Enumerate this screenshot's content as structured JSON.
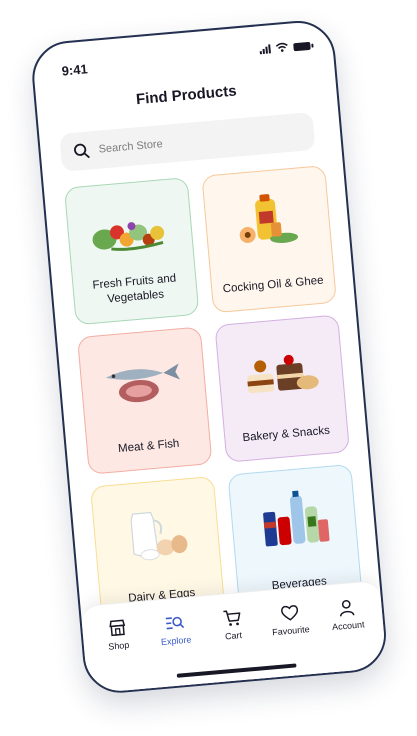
{
  "status_bar": {
    "time": "9:41"
  },
  "page": {
    "title": "Find Products"
  },
  "search": {
    "placeholder": "Search Store"
  },
  "categories": [
    {
      "label": "Fresh Fruits and Vegetables",
      "color": "#eef7f1"
    },
    {
      "label": "Cocking Oil & Ghee",
      "color": "#fff6ee"
    },
    {
      "label": "Meat & Fish",
      "color": "#fde8e4"
    },
    {
      "label": "Bakery & Snacks",
      "color": "#f4ebf7"
    },
    {
      "label": "Dairy & Eggs",
      "color": "#fff8e5"
    },
    {
      "label": "Beverages",
      "color": "#edf7fc"
    }
  ],
  "tabs": [
    {
      "label": "Shop",
      "icon": "store-icon"
    },
    {
      "label": "Explore",
      "icon": "explore-icon",
      "active": true
    },
    {
      "label": "Cart",
      "icon": "cart-icon"
    },
    {
      "label": "Favourite",
      "icon": "heart-icon"
    },
    {
      "label": "Account",
      "icon": "user-icon"
    }
  ],
  "colors": {
    "accent": "#3b5bcc",
    "text": "#181725",
    "frame": "#24304f"
  }
}
